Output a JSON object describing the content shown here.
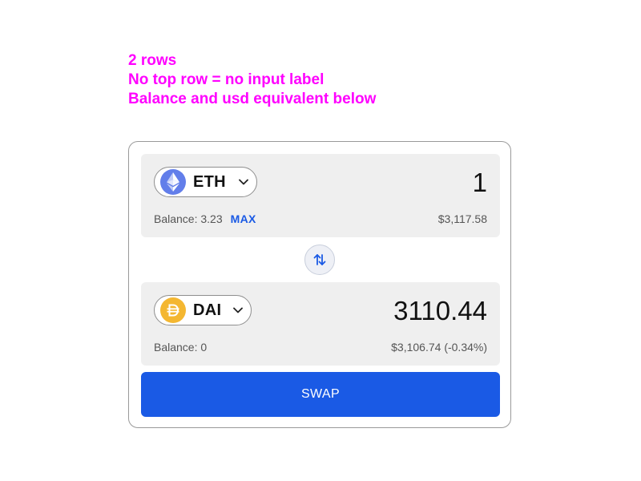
{
  "annotations": [
    "2 rows",
    "No top row = no input label",
    "Balance and usd equivalent below"
  ],
  "colors": {
    "annotation": "#ff00ff",
    "accent": "#1a5ae5",
    "panel_bg": "#efefef",
    "eth_logo": "#627eea",
    "dai_logo": "#f4b731"
  },
  "from": {
    "token": "ETH",
    "token_icon": "ethereum-icon",
    "amount": "1",
    "balance": "Balance: 3.23",
    "max_label": "MAX",
    "usd_value": "$3,117.58"
  },
  "to": {
    "token": "DAI",
    "token_icon": "dai-icon",
    "amount": "3110.44",
    "balance": "Balance: 0",
    "usd_value": "$3,106.74 (-0.34%)"
  },
  "switch_icon": "swap-arrows-icon",
  "swap_label": "SWAP"
}
